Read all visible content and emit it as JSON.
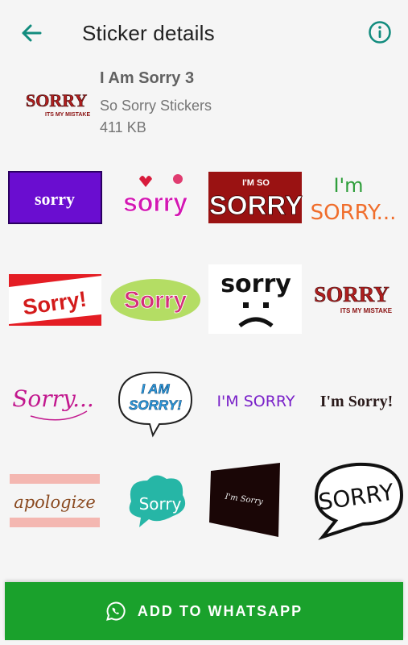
{
  "header": {
    "title": "Sticker details",
    "back_icon": "arrow-left-icon",
    "info_icon": "info-icon",
    "accent": "#128C7E"
  },
  "pack": {
    "name": "I Am Sorry 3",
    "publisher": "So Sorry Stickers",
    "size": "411 KB",
    "icon_text": "SORRY",
    "icon_subtext": "ITS MY MISTAKE"
  },
  "stickers": [
    {
      "text": "sorry"
    },
    {
      "text": "sorry"
    },
    {
      "text": "I'M SO",
      "text2": "SORRY"
    },
    {
      "text": "I'm",
      "text2": "SORRY..."
    },
    {
      "text": "Sorry!"
    },
    {
      "text": "Sorry"
    },
    {
      "text": "sorry"
    },
    {
      "text": "SORRY",
      "text2": "ITS MY MISTAKE"
    },
    {
      "text": "Sorry..."
    },
    {
      "text": "I AM",
      "text2": "SORRY!"
    },
    {
      "text": "I'M SORRY"
    },
    {
      "text": "I'm Sorry!"
    },
    {
      "text": "apologize"
    },
    {
      "text": "Sorry"
    },
    {
      "text": "I'm Sorry"
    },
    {
      "text": "SORRY"
    }
  ],
  "action": {
    "label": "ADD TO WHATSAPP",
    "icon": "whatsapp-icon",
    "color": "#1aa12c"
  }
}
